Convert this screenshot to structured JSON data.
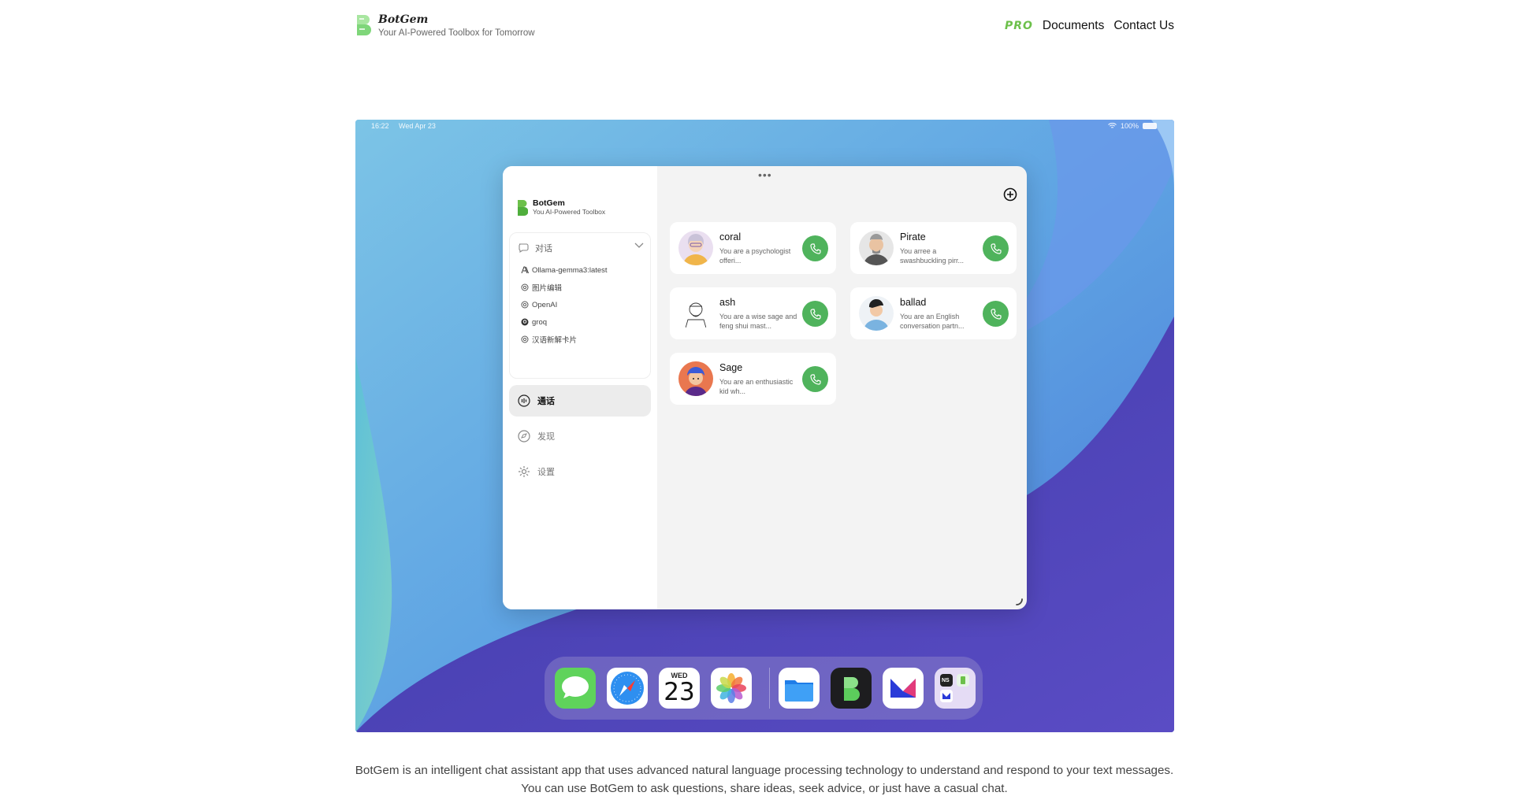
{
  "site": {
    "brand_name": "BotGem",
    "tagline": "Your AI-Powered Toolbox for Tomorrow",
    "nav": {
      "pro": "PRO",
      "documents": "Documents",
      "contact": "Contact Us"
    }
  },
  "device_status": {
    "time": "16:22",
    "date": "Wed Apr 23",
    "battery": "100%"
  },
  "app": {
    "window_dots": "•••",
    "brand_name": "BotGem",
    "brand_tagline": "You AI-Powered Toolbox",
    "chat_group": {
      "label": "对话",
      "items": [
        {
          "label": "Ollama-gemma3:latest",
          "icon": "anthropic-icon"
        },
        {
          "label": "图片编辑",
          "icon": "openai-icon"
        },
        {
          "label": "OpenAI",
          "icon": "openai-icon"
        },
        {
          "label": "groq",
          "icon": "groq-icon"
        },
        {
          "label": "汉语新解卡片",
          "icon": "openai-icon"
        }
      ]
    },
    "nav": {
      "calls": "通话",
      "discover": "发现",
      "settings": "设置"
    },
    "contacts": [
      {
        "name": "coral",
        "desc": "You are a psychologist offeri..."
      },
      {
        "name": "Pirate",
        "desc": "You arree a swashbuckling pirr..."
      },
      {
        "name": "ash",
        "desc": "You are a wise sage and feng shui mast..."
      },
      {
        "name": "ballad",
        "desc": "You are an English conversation partn..."
      },
      {
        "name": "Sage",
        "desc": "You are an enthusiastic kid wh..."
      }
    ]
  },
  "dock": {
    "apps": [
      "Messages",
      "Safari",
      "Calendar",
      "Photos",
      "Files",
      "BotGem",
      "Mail",
      "Apps Folder"
    ],
    "calendar_day": "WED",
    "calendar_date": "23",
    "folder_label": "NS"
  },
  "description": "BotGem is an intelligent chat assistant app that uses advanced natural language processing technology to understand and respond to your text messages. You can use BotGem to ask questions, share ideas, seek advice, or just have a casual chat.",
  "colors": {
    "accent_green": "#4fb35c",
    "pro_green": "#6cc04a"
  }
}
